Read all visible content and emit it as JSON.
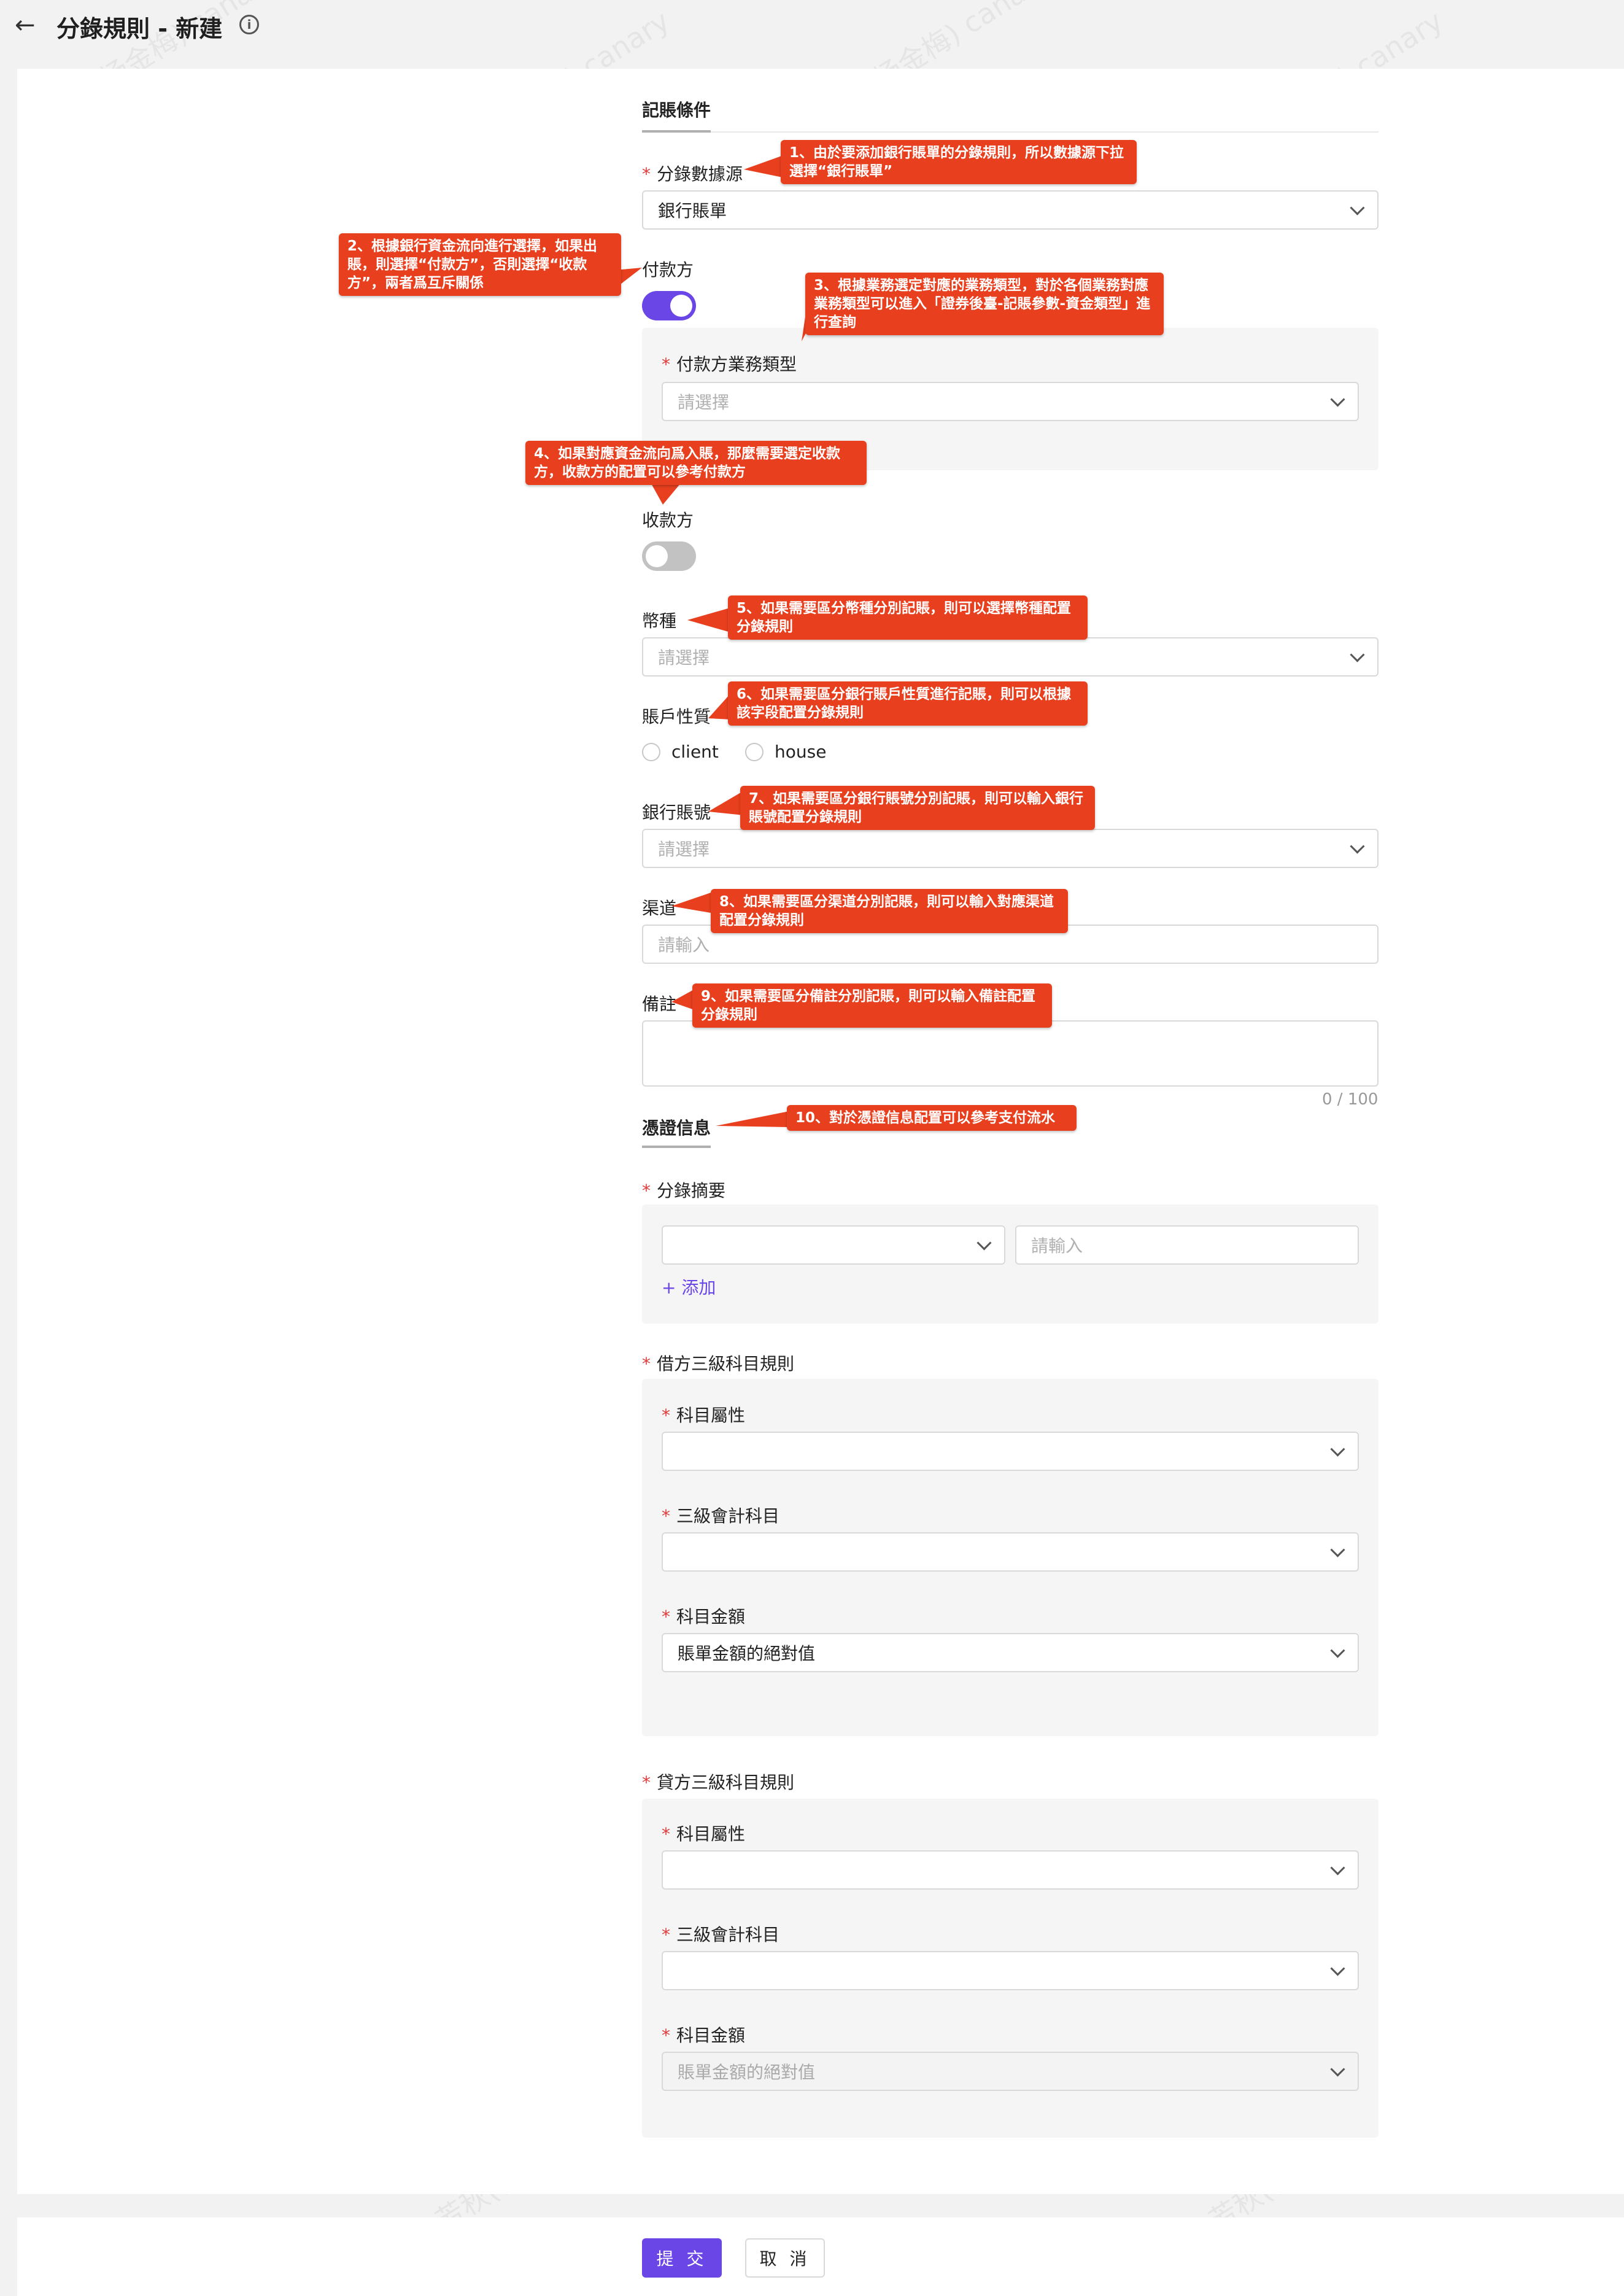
{
  "header": {
    "title": "分錄規則 - 新建"
  },
  "form": {
    "section1_title": "記賬條件",
    "data_source": {
      "label": "分錄數據源",
      "value": "銀行賬單"
    },
    "payer": {
      "label": "付款方",
      "enabled": true,
      "business_type_label": "付款方業務類型",
      "business_type_placeholder": "請選擇"
    },
    "payee": {
      "label": "收款方",
      "enabled": false
    },
    "currency": {
      "label": "幣種",
      "placeholder": "請選擇"
    },
    "account_nature": {
      "label": "賬戶性質",
      "options": [
        "client",
        "house"
      ]
    },
    "bank_account": {
      "label": "銀行賬號",
      "placeholder": "請選擇"
    },
    "channel": {
      "label": "渠道",
      "placeholder": "請輸入"
    },
    "remark": {
      "label": "備註",
      "counter": "0 / 100"
    },
    "section2_title": "憑證信息",
    "summary": {
      "label": "分錄摘要",
      "input_placeholder": "請輸入",
      "add_label": "+ 添加"
    },
    "debit": {
      "label": "借方三級科目規則",
      "attr_label": "科目屬性",
      "account_label": "三級會計科目",
      "amount_label": "科目金額",
      "amount_value": "賬單金額的絕對值"
    },
    "credit": {
      "label": "貸方三級科目規則",
      "attr_label": "科目屬性",
      "account_label": "三級會計科目",
      "amount_label": "科目金額",
      "amount_value": "賬單金額的絕對值"
    }
  },
  "footer": {
    "submit_label": "提 交",
    "cancel_label": "取 消"
  },
  "callouts": {
    "c1": "1、由於要添加銀行賬單的分錄規則，所以數據源下拉選擇“銀行賬單”",
    "c2": "2、根據銀行資金流向進行選擇，如果出賬，則選擇“付款方”，否則選擇“收款方”，兩者爲互斥關係",
    "c3": "3、根據業務選定對應的業務類型，對於各個業務對應業務類型可以進入「證券後臺-記賬參數-資金類型」進行查詢",
    "c4": "4、如果對應資金流向爲入賬，那麼需要選定收款方，收款方的配置可以參考付款方",
    "c5": "5、如果需要區分幣種分別記賬，則可以選擇幣種配置分錄規則",
    "c6": "6、如果需要區分銀行賬戶性質進行記賬，則可以根據該字段配置分錄規則",
    "c7": "7、如果需要區分銀行賬號分別記賬，則可以輸入銀行賬號配置分錄規則",
    "c8": "8、如果需要區分渠道分別記賬，則可以輸入對應渠道配置分錄規則",
    "c9": "9、如果需要區分備註分別記賬，則可以輸入備註配置分錄規則",
    "c10": "10、對於憑證信息配置可以參考支付流水"
  },
  "watermark": "芳秋(杨金梅) canary",
  "colors": {
    "primary": "#6b46e6",
    "callout": "#e8401f",
    "required": "#e03a3a"
  }
}
